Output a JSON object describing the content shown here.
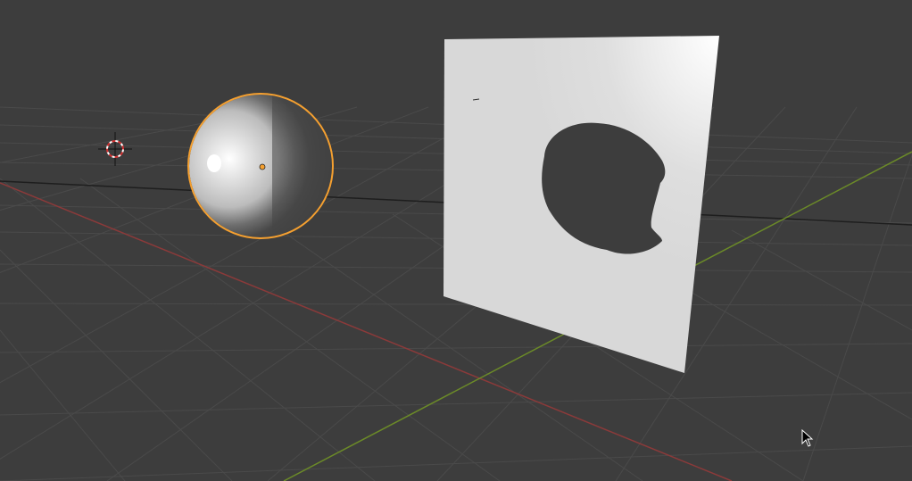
{
  "viewport": {
    "mode": "3d-viewport",
    "background_color": "#3d3d3d",
    "grid_color": "#4a4a4a",
    "x_axis_color": "#8b3a3a",
    "y_axis_color": "#6b8a28"
  },
  "objects": [
    {
      "name": "sphere",
      "selected": true,
      "outline_color": "#f5a030"
    },
    {
      "name": "plane",
      "selected": false,
      "shape": "speech-bubble-cutout"
    }
  ],
  "cursor_3d": {
    "icon": "3d-cursor-icon"
  },
  "mouse_pointer": {
    "icon": "arrow-cursor-icon"
  }
}
